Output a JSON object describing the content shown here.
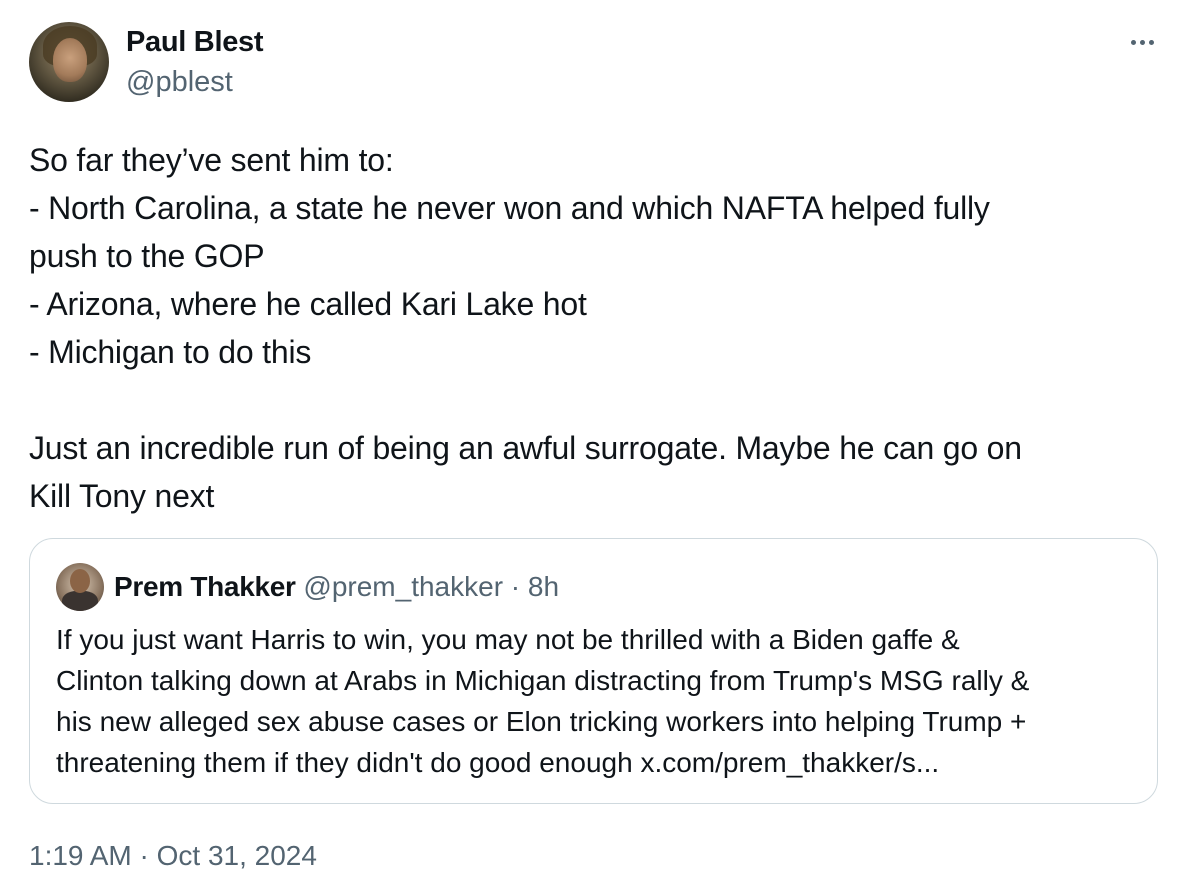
{
  "author": {
    "name": "Paul Blest",
    "handle": "@pblest"
  },
  "more_icon": "more-horizontal-icon",
  "tweet": {
    "lines": [
      "So far they’ve sent him to:",
      "- North Carolina, a state he never won and which NAFTA helped fully",
      "push to the GOP",
      "- Arizona, where he called Kari Lake hot",
      "- Michigan to do this",
      "",
      "Just an incredible run of being an awful surrogate. Maybe he can go on",
      "Kill Tony next"
    ]
  },
  "quote": {
    "name": "Prem Thakker",
    "handle": "@prem_thakker",
    "separator": "·",
    "time": "8h",
    "lines": [
      "If you just want Harris to win, you may not be thrilled with a Biden gaffe &",
      "Clinton talking down at Arabs in Michigan distracting from Trump's MSG rally &",
      "his new alleged sex abuse cases or Elon tricking workers into helping Trump +",
      "threatening them if they didn't do good enough x.com/prem_thakker/s..."
    ]
  },
  "timestamp": "1:19 AM · Oct 31, 2024",
  "colors": {
    "text": "#0f1419",
    "secondary": "#536471",
    "border": "#cfd9de"
  }
}
